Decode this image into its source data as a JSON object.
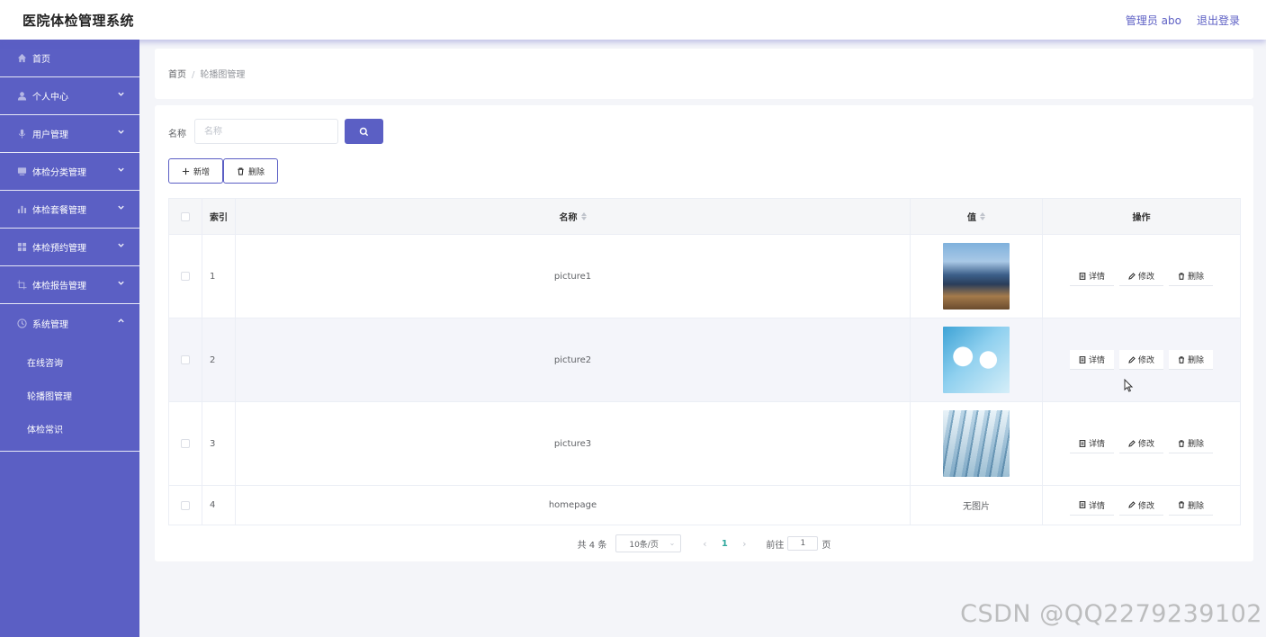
{
  "header": {
    "app_title": "医院体检管理系统",
    "user_label": "管理员 abo",
    "logout_label": "退出登录"
  },
  "sidebar": {
    "items": [
      {
        "label": "首页",
        "icon": "home-icon",
        "expandable": false
      },
      {
        "label": "个人中心",
        "icon": "user-icon",
        "expandable": true
      },
      {
        "label": "用户管理",
        "icon": "microphone-icon",
        "expandable": true
      },
      {
        "label": "体检分类管理",
        "icon": "monitor-icon",
        "expandable": true
      },
      {
        "label": "体检套餐管理",
        "icon": "bar-chart-icon",
        "expandable": true
      },
      {
        "label": "体检预约管理",
        "icon": "grid-icon",
        "expandable": true
      },
      {
        "label": "体检报告管理",
        "icon": "crop-icon",
        "expandable": true
      },
      {
        "label": "系统管理",
        "icon": "clock-icon",
        "expandable": true,
        "expanded": true
      }
    ],
    "subitems": [
      {
        "label": "在线咨询"
      },
      {
        "label": "轮播图管理"
      },
      {
        "label": "体检常识"
      }
    ]
  },
  "breadcrumb": {
    "home": "首页",
    "separator": "/",
    "current": "轮播图管理"
  },
  "search": {
    "label": "名称",
    "placeholder": "名称"
  },
  "actions": {
    "add_label": "新增",
    "delete_label": "删除"
  },
  "table": {
    "headers": {
      "index": "索引",
      "name": "名称",
      "value": "值",
      "ops": "操作"
    },
    "rows": [
      {
        "index": "1",
        "name": "picture1",
        "value_image": "building-photo"
      },
      {
        "index": "2",
        "name": "picture2",
        "value_image": "medical-photo"
      },
      {
        "index": "3",
        "name": "picture3",
        "value_image": "hospital-interior-photo"
      },
      {
        "index": "4",
        "name": "homepage",
        "value_text": "无图片"
      }
    ],
    "op_labels": {
      "detail": "详情",
      "edit": "修改",
      "delete": "删除"
    }
  },
  "pagination": {
    "total_text": "共 4 条",
    "page_size": "10条/页",
    "current_page": "1",
    "goto_label": "前往",
    "goto_value": "1",
    "page_suffix": "页"
  },
  "watermark": "CSDN @QQ2279239102",
  "colors": {
    "accent": "#5b5fc4",
    "page_active": "#2fa89d"
  }
}
